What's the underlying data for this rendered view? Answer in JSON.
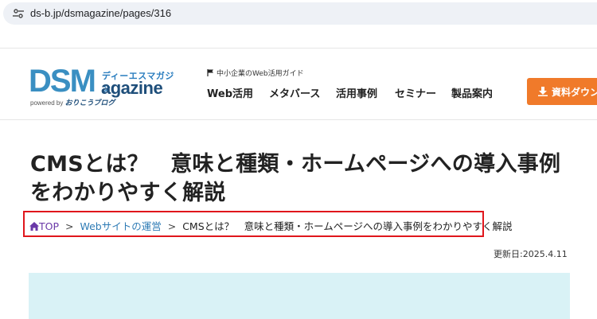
{
  "browser": {
    "url": "ds-b.jp/dsmagazine/pages/316"
  },
  "logo": {
    "main": "DSM",
    "sub": "agazine",
    "kana": "ディーエスマガジン",
    "powered_by": "powered by",
    "powered_brand": "おりこうブログ"
  },
  "header": {
    "tagline": "中小企業のWeb活用ガイド",
    "nav": [
      "Web活用",
      "メタバース",
      "活用事例",
      "セミナー",
      "製品案内"
    ],
    "download_label": "資料ダウン"
  },
  "article": {
    "title": "CMSとは？　意味と種類・ホームページへの導入事例をわかりやすく解説",
    "breadcrumb": {
      "home": "TOP",
      "category": "Webサイトの運営",
      "current": "CMSとは？　意味と種類・ホームページへの導入事例をわかりやすく解説",
      "separator": ">"
    },
    "updated": "更新日:2025.4.11"
  },
  "colors": {
    "accent": "#f07a2a",
    "link": "#2e7bb5",
    "highlight": "#e0161c",
    "banner": "#d9f2f6"
  }
}
